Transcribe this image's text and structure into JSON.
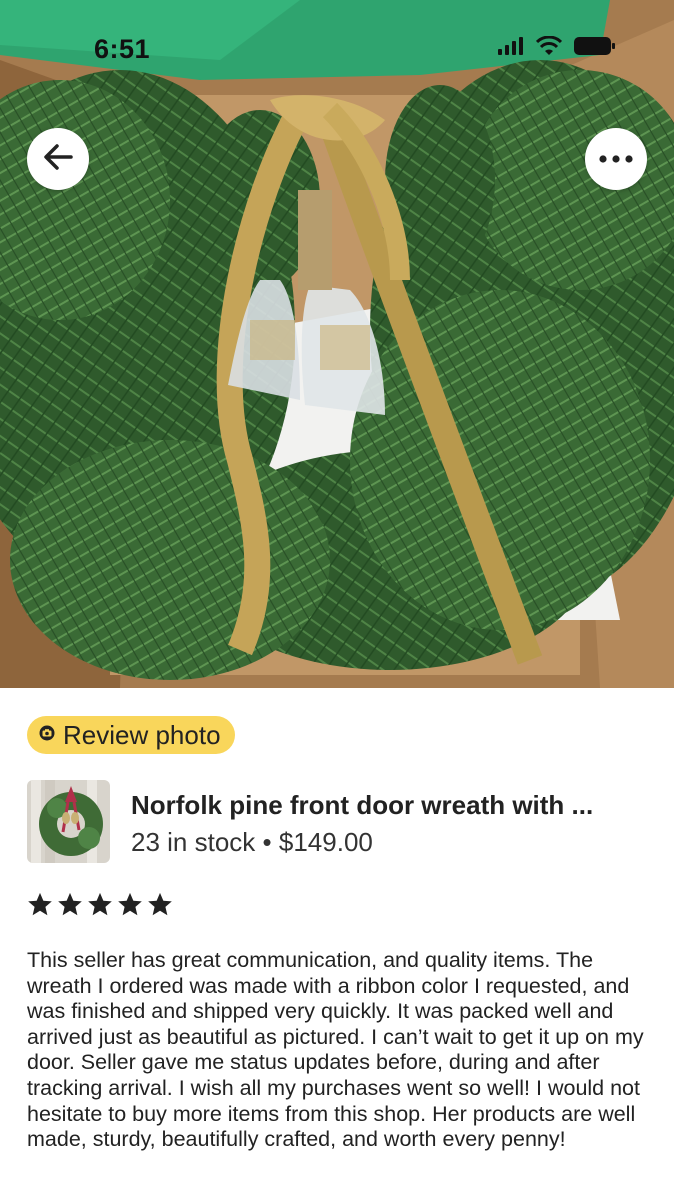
{
  "status_bar": {
    "time": "6:51",
    "icons": [
      "signal-icon",
      "wifi-icon",
      "battery-icon"
    ]
  },
  "nav": {
    "back_icon": "arrow-left-icon",
    "more_icon": "more-horizontal-icon"
  },
  "badge": {
    "label": "Review photo",
    "icon": "camera-icon",
    "color": "#f9d65b"
  },
  "product": {
    "title": "Norfolk pine front door wreath with ...",
    "stock": "23 in stock",
    "separator": "•",
    "price": "$149.00"
  },
  "review": {
    "rating": 5,
    "max_rating": 5,
    "text": "This seller has great communication, and quality items. The wreath I ordered was made with a ribbon color I requested, and was finished and shipped very quickly. It was packed well and arrived just as beautiful as pictured. I can’t wait to get it up on my door. Seller gave me status updates before, during and after tracking arrival. I wish all my purchases went so well! I would not hesitate to buy more items from this shop. Her products are  well made, sturdy, beautifully crafted, and worth every penny!"
  }
}
